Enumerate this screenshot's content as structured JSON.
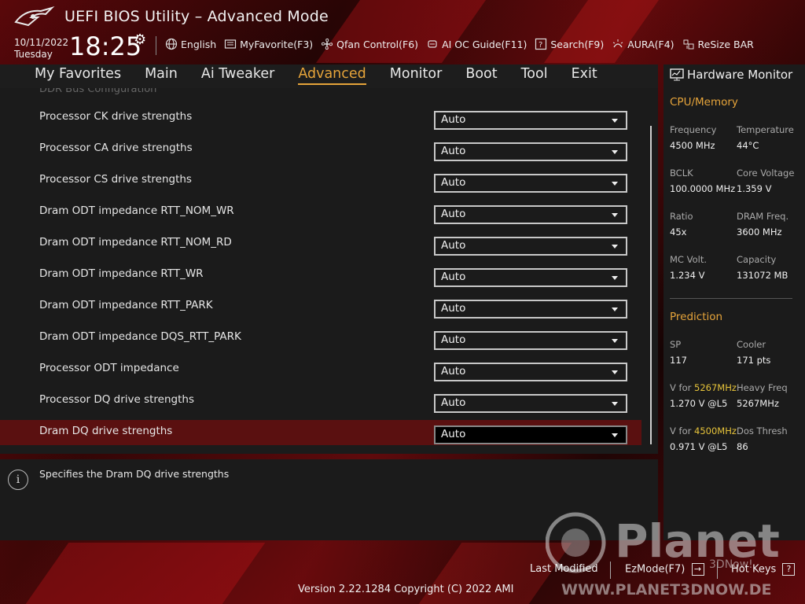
{
  "header": {
    "title": "UEFI BIOS Utility – Advanced Mode",
    "date": "10/11/2022",
    "weekday": "Tuesday",
    "time": "18:25",
    "tools": [
      {
        "label": "English",
        "icon": "globe-icon"
      },
      {
        "label": "MyFavorite(F3)",
        "icon": "favorite-list-icon"
      },
      {
        "label": "Qfan Control(F6)",
        "icon": "fan-icon"
      },
      {
        "label": "AI OC Guide(F11)",
        "icon": "ai-chip-icon"
      },
      {
        "label": "Search(F9)",
        "icon": "search-icon"
      },
      {
        "label": "AURA(F4)",
        "icon": "aura-light-icon"
      },
      {
        "label": "ReSize BAR",
        "icon": "resize-bar-icon"
      }
    ]
  },
  "nav": {
    "tabs": [
      "My Favorites",
      "Main",
      "Ai Tweaker",
      "Advanced",
      "Monitor",
      "Boot",
      "Tool",
      "Exit"
    ],
    "active": "Advanced"
  },
  "content": {
    "section_cut": "DDR Bus Configuration",
    "rows": [
      {
        "label": "Processor CK drive strengths",
        "value": "Auto"
      },
      {
        "label": "Processor CA drive strengths",
        "value": "Auto"
      },
      {
        "label": "Processor CS drive strengths",
        "value": "Auto"
      },
      {
        "label": "Dram ODT impedance RTT_NOM_WR",
        "value": "Auto"
      },
      {
        "label": "Dram ODT impedance RTT_NOM_RD",
        "value": "Auto"
      },
      {
        "label": "Dram ODT impedance RTT_WR",
        "value": "Auto"
      },
      {
        "label": "Dram ODT impedance RTT_PARK",
        "value": "Auto"
      },
      {
        "label": "Dram ODT impedance DQS_RTT_PARK",
        "value": "Auto"
      },
      {
        "label": "Processor ODT impedance",
        "value": "Auto"
      },
      {
        "label": "Processor DQ drive strengths",
        "value": "Auto"
      },
      {
        "label": "Dram DQ drive strengths",
        "value": "Auto",
        "selected": true
      }
    ],
    "help_text": "Specifies the Dram DQ drive strengths"
  },
  "hardware_monitor": {
    "title": "Hardware Monitor",
    "cpu_memory": {
      "title": "CPU/Memory",
      "items": [
        {
          "key": "Frequency",
          "value": "4500 MHz"
        },
        {
          "key": "Temperature",
          "value": "44°C"
        },
        {
          "key": "BCLK",
          "value": "100.0000 MHz"
        },
        {
          "key": "Core Voltage",
          "value": "1.359 V"
        },
        {
          "key": "Ratio",
          "value": "45x"
        },
        {
          "key": "DRAM Freq.",
          "value": "3600 MHz"
        },
        {
          "key": "MC Volt.",
          "value": "1.234 V"
        },
        {
          "key": "Capacity",
          "value": "131072 MB"
        }
      ]
    },
    "prediction": {
      "title": "Prediction",
      "sp_label": "SP",
      "sp_value": "117",
      "cooler_label": "Cooler",
      "cooler_value": "171 pts",
      "vfor_label": "V for",
      "vfor1_freq": "5267MHz",
      "vfor1_value": "1.270 V @L5",
      "heavy_label": "Heavy Freq",
      "heavy_value": "5267MHz",
      "vfor2_freq": "4500MHz",
      "vfor2_value": "0.971 V @L5",
      "dos_label": "Dos Thresh",
      "dos_value": "86"
    }
  },
  "footer": {
    "last_modified": "Last Modified",
    "ezmode": "EzMode(F7)",
    "hotkeys": "Hot Keys",
    "hotkeys_key": "?",
    "version": "Version 2.22.1284 Copyright (C) 2022 AMI"
  },
  "watermark": {
    "brand": "Planet",
    "suffix": "3DNow!",
    "url": "WWW.PLANET3DNOW.DE"
  },
  "colors": {
    "accent": "#e6a43a",
    "highlight": "#e6c33a",
    "selected_row": "#5a1010"
  }
}
